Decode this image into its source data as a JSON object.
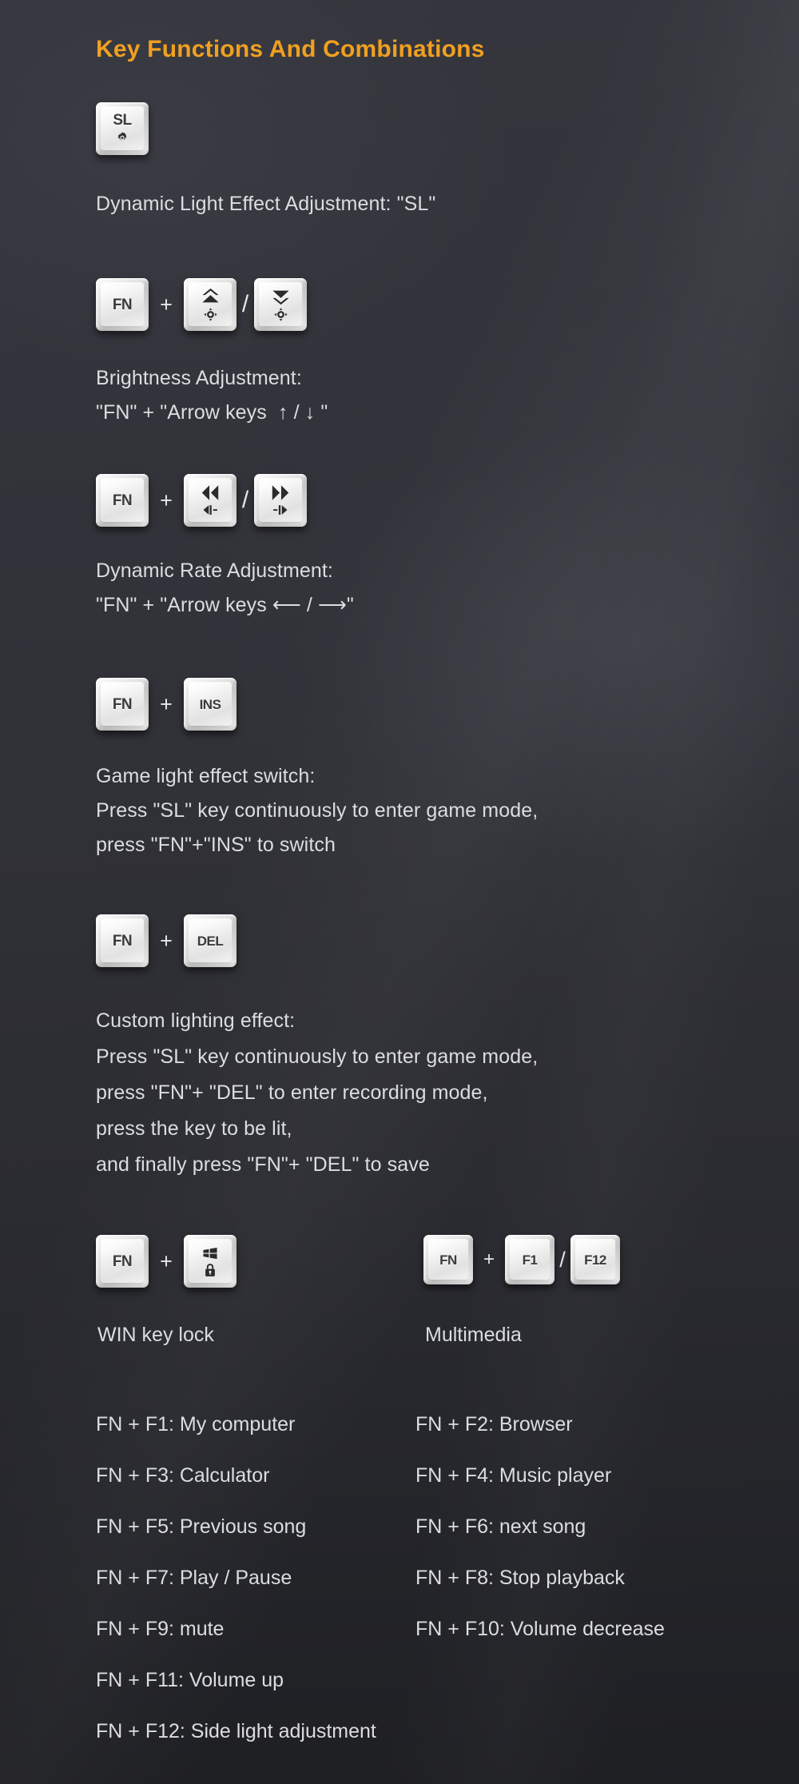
{
  "page": {
    "title": "Key Functions And Combinations",
    "title_color": "#f0a020",
    "background_color": "#32333a",
    "text_color": "#dcdde0"
  },
  "sections": [
    {
      "id": "dynamic-light-effect",
      "keys": [
        {
          "name": "sl-key",
          "legend": "SL",
          "icon": "gear-icon"
        }
      ],
      "description": "Dynamic Light Effect Adjustment: \"SL\""
    },
    {
      "id": "brightness-adjustment",
      "keys": [
        {
          "name": "fn-key",
          "legend": "FN"
        },
        {
          "name": "plus-sign",
          "legend": "+"
        },
        {
          "name": "arrow-up-key",
          "icon": "double-chevron-up-icon",
          "sub_icon": "brightness-up-icon"
        },
        {
          "name": "slash-separator",
          "legend": "/"
        },
        {
          "name": "arrow-down-key",
          "icon": "double-chevron-down-icon",
          "sub_icon": "brightness-down-icon"
        }
      ],
      "description_line1": "Brightness Adjustment:",
      "description_line2": "\"FN\" + \"Arrow keys  ↑ / ↓ \""
    },
    {
      "id": "dynamic-rate-adjustment",
      "keys": [
        {
          "name": "fn-key",
          "legend": "FN"
        },
        {
          "name": "plus-sign",
          "legend": "+"
        },
        {
          "name": "arrow-left-key",
          "icon": "double-chevron-left-icon",
          "sub_icon": "speed-down-icon"
        },
        {
          "name": "slash-separator",
          "legend": "/"
        },
        {
          "name": "arrow-right-key",
          "icon": "double-chevron-right-icon",
          "sub_icon": "speed-up-icon"
        }
      ],
      "description_line1": "Dynamic Rate Adjustment:",
      "description_line2": "\"FN\" + \"Arrow keys ⟵ / ⟶\""
    },
    {
      "id": "game-light-effect-switch",
      "keys": [
        {
          "name": "fn-key",
          "legend": "FN"
        },
        {
          "name": "plus-sign",
          "legend": "+"
        },
        {
          "name": "ins-key",
          "legend": "INS"
        }
      ],
      "description_line1": "Game light effect switch:",
      "description_line2": "Press \"SL\" key continuously to enter game mode,",
      "description_line3": "press \"FN\"+\"INS\" to switch"
    },
    {
      "id": "custom-lighting-effect",
      "keys": [
        {
          "name": "fn-key",
          "legend": "FN"
        },
        {
          "name": "plus-sign",
          "legend": "+"
        },
        {
          "name": "del-key",
          "legend": "DEL"
        }
      ],
      "description_line1": "Custom lighting effect:",
      "description_line2": "Press \"SL\" key continuously to enter game mode,",
      "description_line3": "press \"FN\"+ \"DEL\" to enter recording mode,",
      "description_line4": "press the key to be lit,",
      "description_line5": "and finally press \"FN\"+ \"DEL\" to save"
    },
    {
      "id": "win-key-lock",
      "keys": [
        {
          "name": "fn-key",
          "legend": "FN"
        },
        {
          "name": "plus-sign",
          "legend": "+"
        },
        {
          "name": "win-lock-key",
          "icon": "windows-logo-icon",
          "sub_icon": "lock-icon"
        }
      ],
      "caption": "WIN key lock"
    },
    {
      "id": "multimedia",
      "keys": [
        {
          "name": "fn-key",
          "legend": "FN"
        },
        {
          "name": "plus-sign",
          "legend": "+"
        },
        {
          "name": "f1-key",
          "legend": "F1"
        },
        {
          "name": "slash-separator",
          "legend": "/"
        },
        {
          "name": "f12-key",
          "legend": "F12"
        }
      ],
      "caption": "Multimedia"
    }
  ],
  "fn_shortcuts": [
    {
      "left": "FN + F1: My computer",
      "right": "FN + F2: Browser"
    },
    {
      "left": "FN + F3: Calculator",
      "right": "FN + F4: Music player"
    },
    {
      "left": "FN + F5: Previous song",
      "right": "FN + F6: next song"
    },
    {
      "left": "FN + F7: Play / Pause",
      "right": "FN + F8: Stop playback"
    },
    {
      "left": "FN + F9: mute",
      "right": "FN + F10: Volume decrease"
    },
    {
      "left": "FN + F11: Volume up",
      "right": ""
    },
    {
      "left": "FN + F12: Side light adjustment",
      "right": ""
    }
  ]
}
